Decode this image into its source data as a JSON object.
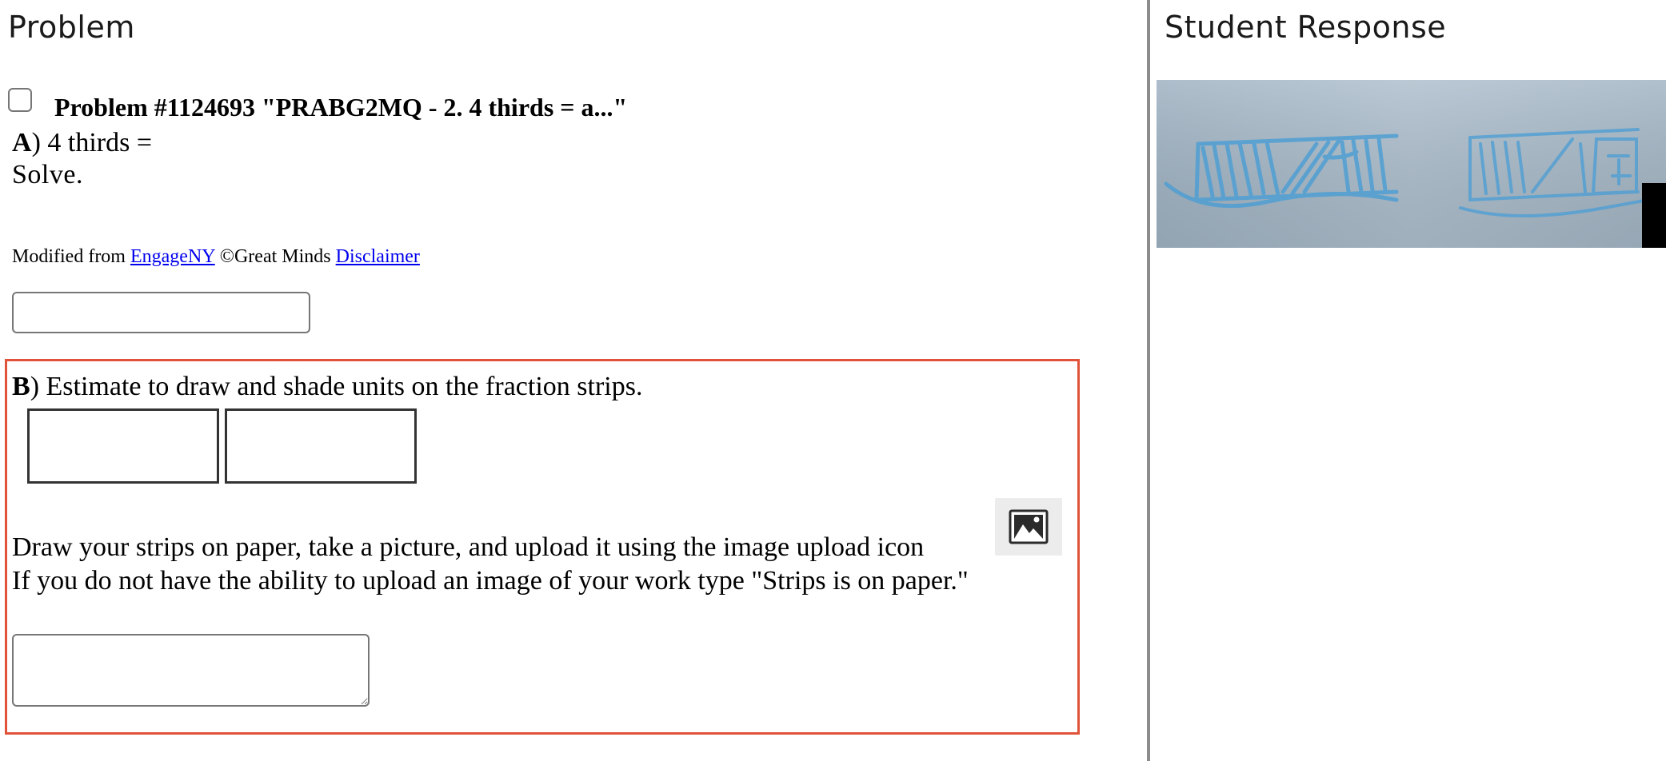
{
  "left_panel": {
    "heading": "Problem",
    "problem_title": "Problem #1124693 \"PRABG2MQ - 2. 4 thirds = a...\"",
    "part_a": {
      "letter": "A",
      "separator": ")",
      "prompt": " 4 thirds =",
      "instruction": "Solve.",
      "answer_value": ""
    },
    "credits": {
      "prefix": "Modified from ",
      "link1": "EngageNY",
      "middle": " ©Great Minds ",
      "link2": "Disclaimer"
    },
    "part_b": {
      "letter": "B",
      "separator": ")",
      "prompt": " Estimate to draw and shade units on the fraction strips.",
      "upload_instruction": "Draw your strips on paper, take a picture, and upload it using the image upload icon",
      "no_upload_instruction": "If you do not have the ability to upload an image of your work type \"Strips is on paper.\"",
      "answer_value": "",
      "upload_icon": "image-upload-icon",
      "highlight_color": "#e0533a"
    }
  },
  "right_panel": {
    "heading": "Student Response",
    "response_image_icon": "student-work-photo"
  },
  "colors": {
    "divider": "#8c8c8c",
    "link": "#0000ee",
    "ink": "#4f9fd4"
  }
}
